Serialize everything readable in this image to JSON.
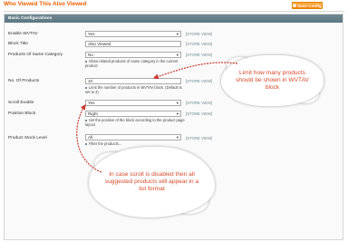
{
  "page": {
    "title": "Who Viewed This Also Viewed",
    "save_button": "Save Config"
  },
  "section": {
    "title": "Basic Configurations"
  },
  "fields": [
    {
      "label": "Enable WVTAV",
      "value": "Yes",
      "scope": "[STORE VIEW]"
    },
    {
      "label": "Block Title",
      "value": "Also Viewed",
      "scope": "[STORE VIEW]"
    },
    {
      "label": "Products Of Same Category",
      "value": "No",
      "scope": "[STORE VIEW]",
      "note": "Show related products of same category in the current product"
    },
    {
      "label": "No. Of Products",
      "value": "10",
      "scope": "[STORE VIEW]",
      "note": "Limit the number of products in WVTAV block. (Default is set to 4)"
    },
    {
      "label": "Scroll Enable",
      "value": "Yes",
      "scope": "[STORE VIEW]"
    },
    {
      "label": "Position Block",
      "value": "Right",
      "scope": "[STORE VIEW]",
      "note": "Set the position of the block according to the product page layout"
    },
    {
      "label": "Product Stock Level",
      "value": "All",
      "scope": "[STORE VIEW]",
      "note": "Filter the products..."
    }
  ],
  "callouts": {
    "limit": "Limit how many products should be shown in WVTAV block",
    "scroll": "In case scroll is disabled then all suggested products will appear in a list format"
  },
  "colors": {
    "title_orange": "#eb5e00",
    "button_orange": "#f18200",
    "section_header": "#5c7882",
    "callout_text": "#d6492a",
    "arrow": "#c8372f"
  },
  "icons": {
    "save": "check-circle-icon",
    "collapse": "minus-circle-icon",
    "dropdown": "chevron-down-icon"
  }
}
